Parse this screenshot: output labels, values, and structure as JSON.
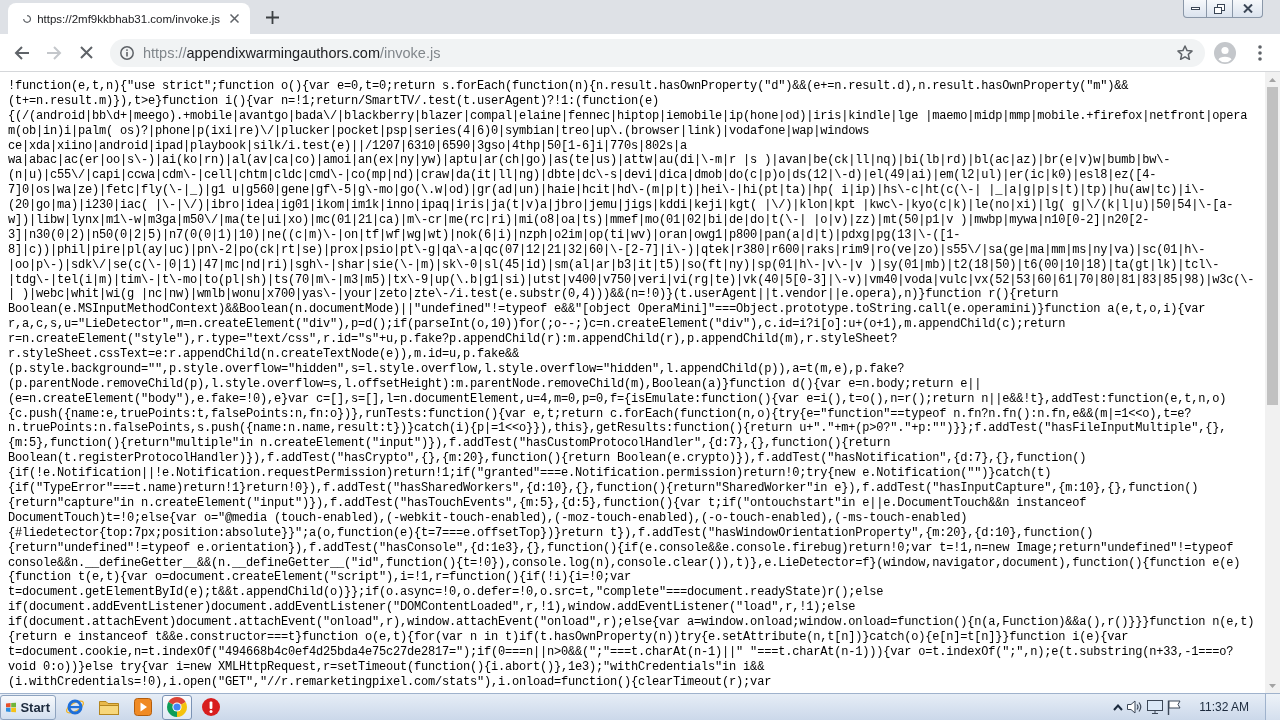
{
  "tabs": [
    {
      "title": "https://2mf9kkbhab31.com/invoke.js",
      "selected": true,
      "loading": true
    }
  ],
  "nav_buttons": [
    {
      "kind": "back",
      "disabled": false
    },
    {
      "kind": "forward",
      "disabled": true
    },
    {
      "kind": "stop",
      "disabled": false
    }
  ],
  "address_bar": {
    "scheme": "https://",
    "host": "appendixwarmingauthors.com",
    "path": "/invoke.js",
    "bookmarked": false
  },
  "page": {
    "lines": [
      "!function(e,t,n){\"use strict\";function o(){var e=0,t=0;return s.forEach(function(n){n.result.hasOwnProperty(\"d\")&&(e+=n.result.d),n.result.hasOwnProperty(\"m\")&&",
      "(t+=n.result.m)}),t>e}function i(){var n=!1;return/SmartTV/.test(t.userAgent)?!1:(function(e)",
      "{(/(android|bb\\d+|meego).+mobile|avantgo|bada\\/|blackberry|blazer|compal|elaine|fennec|hiptop|iemobile|ip(hone|od)|iris|kindle|lge |maemo|midp|mmp|mobile.+firefox|netfront|opera",
      "m(ob|in)i|palm( os)?|phone|p(ixi|re)\\/|plucker|pocket|psp|series(4|6)0|symbian|treo|up\\.(browser|link)|vodafone|wap|windows",
      "ce|xda|xiino|android|ipad|playbook|silk/i.test(e)||/1207|6310|6590|3gso|4thp|50[1-6]i|770s|802s|a",
      "wa|abac|ac(er|oo|s\\-)|ai(ko|rn)|al(av|ca|co)|amoi|an(ex|ny|yw)|aptu|ar(ch|go)|as(te|us)|attw|au(di|\\-m|r |s )|avan|be(ck|ll|nq)|bi(lb|rd)|bl(ac|az)|br(e|v)w|bumb|bw\\-",
      "(n|u)|c55\\/|capi|ccwa|cdm\\-|cell|chtm|cldc|cmd\\-|co(mp|nd)|craw|da(it|ll|ng)|dbte|dc\\-s|devi|dica|dmob|do(c|p)o|ds(12|\\-d)|el(49|ai)|em(l2|ul)|er(ic|k0)|esl8|ez([4-",
      "7]0|os|wa|ze)|fetc|fly(\\-|_)|g1 u|g560|gene|gf\\-5|g\\-mo|go(\\.w|od)|gr(ad|un)|haie|hcit|hd\\-(m|p|t)|hei\\-|hi(pt|ta)|hp( i|ip)|hs\\-c|ht(c(\\-| |_|a|g|p|s|t)|tp)|hu(aw|tc)|i\\-",
      "(20|go|ma)|i230|iac( |\\-|\\/)|ibro|idea|ig01|ikom|im1k|inno|ipaq|iris|ja(t|v)a|jbro|jemu|jigs|kddi|keji|kgt( |\\/)|klon|kpt |kwc\\-|kyo(c|k)|le(no|xi)|lg( g|\\/(k|l|u)|50|54|\\-[a-",
      "w])|libw|lynx|m1\\-w|m3ga|m50\\/|ma(te|ui|xo)|mc(01|21|ca)|m\\-cr|me(rc|ri)|mi(o8|oa|ts)|mmef|mo(01|02|bi|de|do|t(\\-| |o|v)|zz)|mt(50|p1|v )|mwbp|mywa|n10[0-2]|n20[2-",
      "3]|n30(0|2)|n50(0|2|5)|n7(0(0|1)|10)|ne((c|m)\\-|on|tf|wf|wg|wt)|nok(6|i)|nzph|o2im|op(ti|wv)|oran|owg1|p800|pan(a|d|t)|pdxg|pg(13|\\-([1-",
      "8]|c))|phil|pire|pl(ay|uc)|pn\\-2|po(ck|rt|se)|prox|psio|pt\\-g|qa\\-a|qc(07|12|21|32|60|\\-[2-7]|i\\-)|qtek|r380|r600|raks|rim9|ro(ve|zo)|s55\\/|sa(ge|ma|mm|ms|ny|va)|sc(01|h\\-",
      "|oo|p\\-)|sdk\\/|se(c(\\-|0|1)|47|mc|nd|ri)|sgh\\-|shar|sie(\\-|m)|sk\\-0|sl(45|id)|sm(al|ar|b3|it|t5)|so(ft|ny)|sp(01|h\\-|v\\-|v )|sy(01|mb)|t2(18|50)|t6(00|10|18)|ta(gt|lk)|tcl\\-",
      "|tdg\\-|tel(i|m)|tim\\-|t\\-mo|to(pl|sh)|ts(70|m\\-|m3|m5)|tx\\-9|up(\\.b|g1|si)|utst|v400|v750|veri|vi(rg|te)|vk(40|5[0-3]|\\-v)|vm40|voda|vulc|vx(52|53|60|61|70|80|81|83|85|98)|w3c(\\-",
      "| )|webc|whit|wi(g |nc|nw)|wmlb|wonu|x700|yas\\-|your|zeto|zte\\-/i.test(e.substr(0,4)))&&(n=!0)}(t.userAgent||t.vendor||e.opera),n)}function r(){return",
      "Boolean(e.MSInputMethodContext)&&Boolean(n.documentMode)||\"undefined\"!=typeof e&&\"[object OperaMini]\"===Object.prototype.toString.call(e.operamini)}function a(e,t,o,i){var",
      "r,a,c,s,u=\"LieDetector\",m=n.createElement(\"div\"),p=d();if(parseInt(o,10))for(;o--;)c=n.createElement(\"div\"),c.id=i?i[o]:u+(o+1),m.appendChild(c);return",
      "r=n.createElement(\"style\"),r.type=\"text/css\",r.id=\"s\"+u,p.fake?p.appendChild(r):m.appendChild(r),p.appendChild(m),r.styleSheet?",
      "r.styleSheet.cssText=e:r.appendChild(n.createTextNode(e)),m.id=u,p.fake&&",
      "(p.style.background=\"\",p.style.overflow=\"hidden\",s=l.style.overflow,l.style.overflow=\"hidden\",l.appendChild(p)),a=t(m,e),p.fake?",
      "(p.parentNode.removeChild(p),l.style.overflow=s,l.offsetHeight):m.parentNode.removeChild(m),Boolean(a)}function d(){var e=n.body;return e||",
      "(e=n.createElement(\"body\"),e.fake=!0),e}var c=[],s=[],l=n.documentElement,u=4,m=0,p=0,f={isEmulate:function(){var e=i(),t=o(),n=r();return n||e&&!t},addTest:function(e,t,n,o)",
      "{c.push({name:e,truePoints:t,falsePoints:n,fn:o})},runTests:function(){var e,t;return c.forEach(function(n,o){try{e=\"function\"==typeof n.fn?n.fn():n.fn,e&&(m|=1<<o),t=e?",
      "n.truePoints:n.falsePoints,s.push({name:n.name,result:t})}catch(i){p|=1<<o}}),this},getResults:function(){return u+\".\"+m+(p>0?\".\"+p:\"\")}};f.addTest(\"hasFileInputMultiple\",{},",
      "{m:5},function(){return\"multiple\"in n.createElement(\"input\")}),f.addTest(\"hasCustomProtocolHandler\",{d:7},{},function(){return",
      "Boolean(t.registerProtocolHandler)}),f.addTest(\"hasCrypto\",{},{m:20},function(){return Boolean(e.crypto)}),f.addTest(\"hasNotification\",{d:7},{},function()",
      "{if(!e.Notification||!e.Notification.requestPermission)return!1;if(\"granted\"===e.Notification.permission)return!0;try{new e.Notification(\"\")}catch(t)",
      "{if(\"TypeError\"===t.name)return!1}return!0}),f.addTest(\"hasSharedWorkers\",{d:10},{},function(){return\"SharedWorker\"in e}),f.addTest(\"hasInputCapture\",{m:10},{},function()",
      "{return\"capture\"in n.createElement(\"input\")}),f.addTest(\"hasTouchEvents\",{m:5},{d:5},function(){var t;if(\"ontouchstart\"in e||e.DocumentTouch&&n instanceof",
      "DocumentTouch)t=!0;else{var o=\"@media (touch-enabled),(-webkit-touch-enabled),(-moz-touch-enabled),(-o-touch-enabled),(-ms-touch-enabled)",
      "{#liedetector{top:7px;position:absolute}}\";a(o,function(e){t=7===e.offsetTop})}return t}),f.addTest(\"hasWindowOrientationProperty\",{m:20},{d:10},function()",
      "{return\"undefined\"!=typeof e.orientation}),f.addTest(\"hasConsole\",{d:1e3},{},function(){if(e.console&&e.console.firebug)return!0;var t=!1,n=new Image;return\"undefined\"!=typeof",
      "console&&n.__defineGetter__&&(n.__defineGetter__(\"id\",function(){t=!0}),console.log(n),console.clear()),t)},e.LieDetector=f}(window,navigator,document),function(){function e(e)",
      "{function t(e,t){var o=document.createElement(\"script\"),i=!1,r=function(){if(!i){i=!0;var",
      "t=document.getElementById(e);t&&t.appendChild(o)}};if(o.async=!0,o.defer=!0,o.src=t,\"complete\"===document.readyState)r();else",
      "if(document.addEventListener)document.addEventListener(\"DOMContentLoaded\",r,!1),window.addEventListener(\"load\",r,!1);else",
      "if(document.attachEvent)document.attachEvent(\"onload\",r),window.attachEvent(\"onload\",r);else{var a=window.onload;window.onload=function(){n(a,Function)&&a(),r()}}}function n(e,t)",
      "{return e instanceof t&&e.constructor===t}function o(e,t){for(var n in t)if(t.hasOwnProperty(n))try{e.setAttribute(n,t[n])}catch(o){e[n]=t[n]}}function i(e){var",
      "t=document.cookie,n=t.indexOf(\"494668b4c0ef4d25bda4e75c27de2817=\");if(0===n||n>0&&(\";\"===t.charAt(n-1)||\" \"===t.charAt(n-1))){var o=t.indexOf(\";\",n);e(t.substring(n+33,-1===o?",
      "void 0:o))}else try{var i=new XMLHttpRequest,r=setTimeout(function(){i.abort()},1e3);\"withCredentials\"in i&&",
      "(i.withCredentials=!0),i.open(\"GET\",\"//r.remarketingpixel.com/stats\"),i.onload=function(){clearTimeout(r);var"
    ]
  },
  "taskbar": {
    "start_label": "Start",
    "apps": [
      {
        "kind": "ie",
        "active": false
      },
      {
        "kind": "folder",
        "active": false
      },
      {
        "kind": "player",
        "active": false
      },
      {
        "kind": "chrome",
        "active": true
      },
      {
        "kind": "alert",
        "active": false
      }
    ],
    "clock": "11:32 AM"
  }
}
